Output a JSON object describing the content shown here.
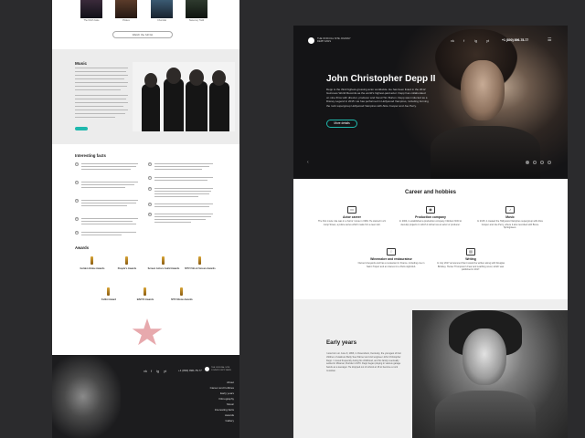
{
  "left_page": {
    "posters": [
      "The Ninth Gate",
      "Pirates",
      "Chocolat",
      "Sweeney Todd"
    ],
    "watch_button": "Watch the full list",
    "music": {
      "title": "Music"
    },
    "facts": {
      "title": "Interesting facts",
      "numbers": [
        "1",
        "2",
        "3",
        "4",
        "5",
        "6",
        "7",
        "8",
        "9",
        "10"
      ]
    },
    "awards": {
      "title": "Awards",
      "items": [
        "Golden Globe Awards",
        "People's Awards",
        "Screen Actors Guild Awards",
        "MTV Film & Screen Awards",
        "Fellini Award",
        "BAFTA Awards",
        "MTV Movie Awards",
        "Saturn Award"
      ]
    },
    "footer": {
      "social": [
        "vk",
        "f",
        "ig",
        "yt"
      ],
      "phone": "+1 (800) 896-78-77",
      "logo_text": "THE OFFICIAL SITE JOHNNY DEPP FANS",
      "nav": [
        "About",
        "Career and hobbies",
        "Early years",
        "Filmography",
        "Music",
        "Interesting facts",
        "Awards",
        "Gallery"
      ]
    }
  },
  "right_page": {
    "header": {
      "logo_text": "THE OFFICIAL SITE JOHNNY DEPP FANS",
      "social": [
        "vk",
        "f",
        "ig",
        "yt"
      ],
      "phone": "+1 (800) 896-78-77",
      "menu_icon": "menu-icon"
    },
    "hero": {
      "title": "John Christopher Depp II",
      "text": "Depp is the third highest-grossing actor worldwide. He has been listed in the 2012 Guinness World Records as the world's highest-paid actor. Depp has collaborated on nine films with director, producer and friend Tim Burton. Depp was inducted as a Disney Legend in 2015. He has performed in Hollywood Vampires, including forming the rock supergroup Hollywood Vampires with Alice Cooper and Joe Perry.",
      "button": "More details",
      "arrow": "‹"
    },
    "career": {
      "title": "Career and hobbies",
      "items": [
        {
          "label": "Actor career",
          "icon": "film-icon",
          "text": "The first movie role was in a horror movie in 1984. He starred in 21 Jump Street, a police series which made him a teen idol."
        },
        {
          "label": "Production company",
          "icon": "camera-icon",
          "text": "In 2004, it established a production company Infinitum Nihil to develop projects in which it will act as an actor or producer."
        },
        {
          "label": "Music",
          "icon": "guitar-icon",
          "text": "In 2015, it created the Hollywood Vampires supergroup with Alice Cooper and Joe Perry, where it also recorded with Bruce Springsteen."
        },
        {
          "label": "Winemaker and restaurateur",
          "icon": "glass-icon",
          "text": "Owned vineyards and has a restaurant in France, including one in Saint-Tropez and an interest in a Paris nightclub."
        },
        {
          "label": "Writing",
          "icon": "book-icon",
          "text": "In July 2017 announced that it would be written along with Douglas Brinkley. Hunter Thompson's Fear and Loathing novel, which was published in 2017."
        }
      ]
    },
    "early_years": {
      "title": "Early years",
      "text": "I was born on June 9, 1963, in Owensboro, Kentucky, the youngest of four children of waitress Betty Sue Palmer and civil engineer John Christopher Depp. I moved frequently during his childhood, and his family eventually settled in Miramar, Florida in 1970. Depp began playing in various garage bands as a teenager. He dropped out of school at 16 to become a rock musician."
    }
  }
}
